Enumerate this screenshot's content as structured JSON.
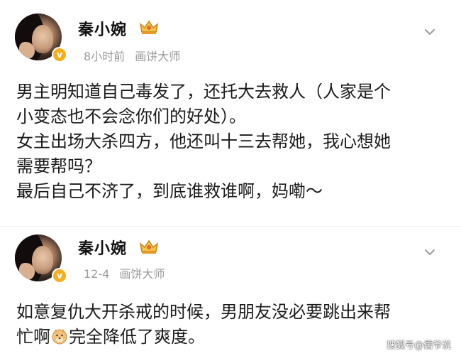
{
  "posts": [
    {
      "username": "秦小婉",
      "time": "8小时前",
      "source": "画饼大师",
      "verified_mark": "v",
      "content_lines": [
        "男主明知道自己毒发了，还托大去救人（人家是个",
        "小变态也不会念你们的好处）。",
        "女主出场大杀四方，他还叫十三去帮她，我心想她",
        "需要帮吗？",
        "最后自己不济了，到底谁救谁啊，妈嘞～"
      ]
    },
    {
      "username": "秦小婉",
      "time": "12-4",
      "source": "画饼大师",
      "verified_mark": "v",
      "content_line_1": "如意复仇大开杀戒的时候，男朋友没必要跳出来帮",
      "content_line_2_before": "忙啊",
      "content_line_2_after": "完全降低了爽度。",
      "emoji": "doge-icon"
    }
  ],
  "icons": {
    "vip_badge": "crown-badge-icon",
    "more": "chevron-down-icon",
    "verified": "verified-v-icon"
  },
  "colors": {
    "verified": "#f4b01c",
    "meta_text": "#9a9a9a",
    "badge_gold": "#e8a317"
  },
  "watermark": "搜狐号@儒爷说"
}
